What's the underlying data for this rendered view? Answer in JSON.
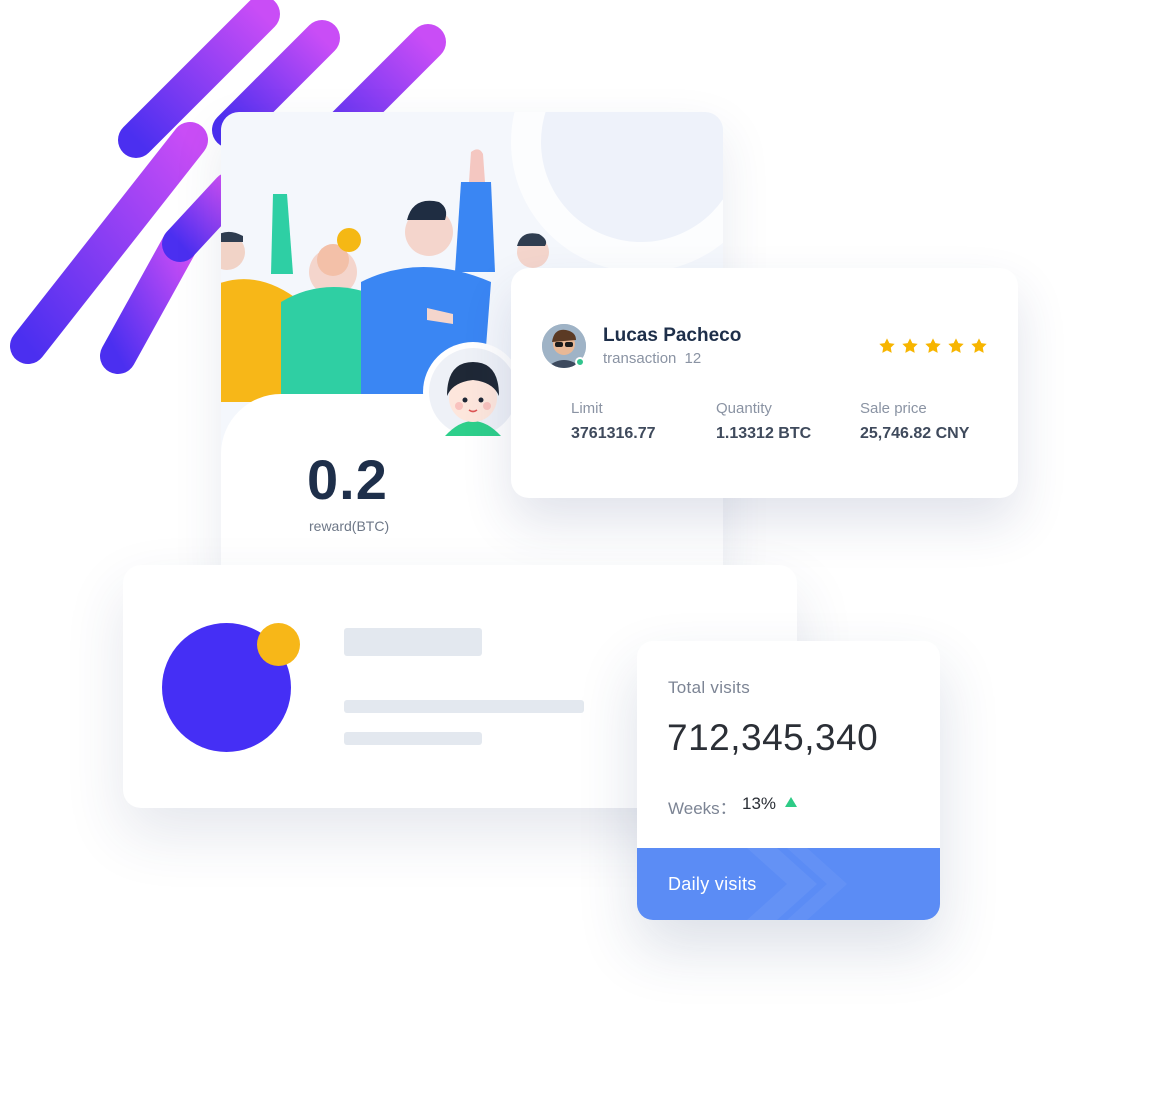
{
  "reward": {
    "value": "0.2",
    "label": "reward(BTC)"
  },
  "transaction": {
    "name": "Lucas Pacheco",
    "transaction_label": "transaction",
    "transaction_count": "12",
    "rating": 5,
    "columns": [
      {
        "label": "Limit",
        "value": "3761316.77"
      },
      {
        "label": "Quantity",
        "value": "1.13312 BTC"
      },
      {
        "label": "Sale price",
        "value": "25,746.82 CNY"
      }
    ]
  },
  "visits": {
    "title": "Total visits",
    "total": "712,345,340",
    "weeks_label": "Weeks：",
    "weeks_value": "13%",
    "footer_label": "Daily visits"
  },
  "colors": {
    "purple_start": "#c34bf5",
    "purple_end": "#5a34f1",
    "accent_blue": "#5b8cf5",
    "indigo": "#452ff5",
    "star": "#f7b500",
    "up_green": "#2ecb86"
  },
  "icons": {
    "rating": "star-icon",
    "trend": "triangle-up-icon",
    "online": "online-dot-icon"
  }
}
